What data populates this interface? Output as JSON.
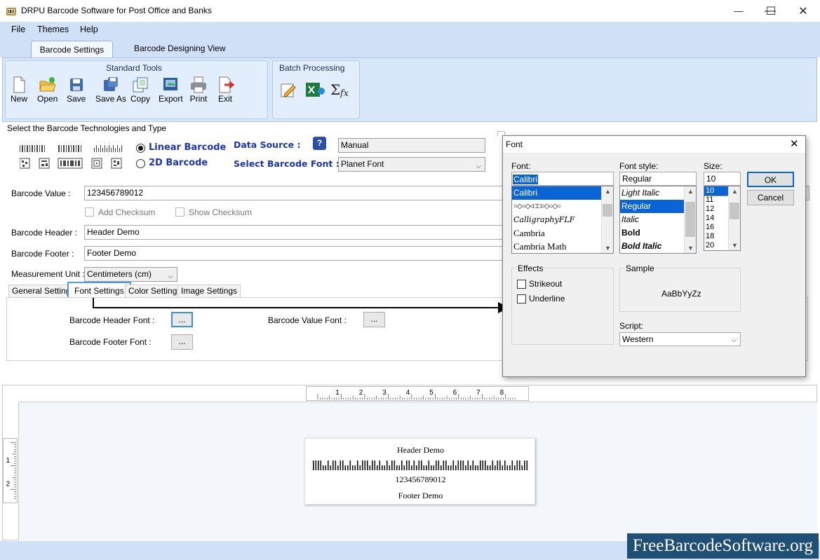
{
  "app": {
    "title": "DRPU Barcode Software for Post Office and Banks",
    "window_controls": {
      "minimize": "—",
      "maximize": "☐",
      "close": "✕"
    }
  },
  "menu": {
    "file": "File",
    "themes": "Themes",
    "help": "Help"
  },
  "ribbon_tabs": {
    "settings": "Barcode Settings",
    "designing": "Barcode Designing View"
  },
  "standard_tools": {
    "title": "Standard Tools",
    "items": [
      {
        "label": "New",
        "icon": "new-file-icon"
      },
      {
        "label": "Open",
        "icon": "open-folder-icon"
      },
      {
        "label": "Save",
        "icon": "save-icon"
      },
      {
        "label": "Save As",
        "icon": "save-as-icon"
      },
      {
        "label": "Copy",
        "icon": "copy-icon"
      },
      {
        "label": "Export",
        "icon": "export-icon"
      },
      {
        "label": "Print",
        "icon": "print-icon"
      },
      {
        "label": "Exit",
        "icon": "exit-icon"
      }
    ]
  },
  "batch_processing": {
    "title": "Batch Processing",
    "icons": [
      "edit-batch-icon",
      "excel-icon",
      "formula-icon"
    ]
  },
  "technology": {
    "section_title": "Select the Barcode Technologies and Type",
    "linear_label": "Linear Barcode",
    "twod_label": "2D Barcode",
    "selected": "Linear Barcode",
    "data_source_label": "Data Source :",
    "data_source_value": "Manual",
    "font_label": "Select Barcode Font :",
    "font_value": "Planet Font"
  },
  "form": {
    "barcode_value_label": "Barcode Value :",
    "barcode_value": "123456789012",
    "add_checksum": "Add Checksum",
    "show_checksum": "Show Checksum",
    "header_label": "Barcode Header :",
    "header_value": "Header Demo",
    "footer_label": "Barcode Footer :",
    "footer_value": "Footer Demo",
    "unit_label": "Measurement Unit :",
    "unit_value": "Centimeters (cm)"
  },
  "subtabs": [
    "General Settings",
    "Font Settings",
    "Color Settings",
    "Image Settings"
  ],
  "font_settings": {
    "header_font": "Barcode Header Font :",
    "footer_font": "Barcode Footer Font :",
    "value_font": "Barcode Value Font :",
    "button": "..."
  },
  "ruler": {
    "h_ticks": [
      "1",
      "2",
      "3",
      "4",
      "5",
      "6",
      "7",
      "8"
    ],
    "v_ticks": [
      "1",
      "2"
    ]
  },
  "preview": {
    "header": "Header Demo",
    "value": "123456789012",
    "footer": "Footer Demo"
  },
  "watermark": "FreeBarcodeSoftware.org",
  "font_dialog": {
    "title": "Font",
    "font_label": "Font:",
    "font_value": "Calibri",
    "font_list": [
      "Calibri",
      "○◇○◇○□□○◇○◇○",
      "CalligraphyFLF",
      "Cambria",
      "Cambria Math"
    ],
    "style_label": "Font style:",
    "style_value": "Regular",
    "style_list": [
      "Light Italic",
      "Regular",
      "Italic",
      "Bold",
      "Bold Italic"
    ],
    "size_label": "Size:",
    "size_value": "10",
    "size_list": [
      "10",
      "11",
      "12",
      "14",
      "16",
      "18",
      "20"
    ],
    "ok": "OK",
    "cancel": "Cancel",
    "effects_title": "Effects",
    "strikeout": "Strikeout",
    "underline": "Underline",
    "sample_title": "Sample",
    "sample_text": "AaBbYyZz",
    "script_label": "Script:",
    "script_value": "Western"
  }
}
